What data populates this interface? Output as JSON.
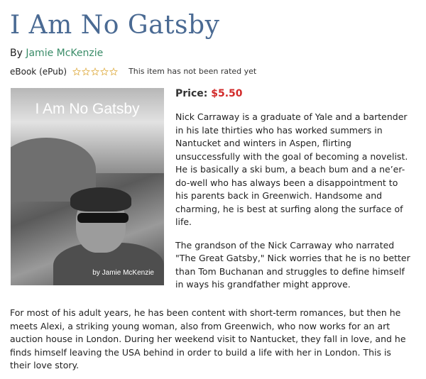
{
  "book": {
    "title": "I Am No Gatsby",
    "by_prefix": "By ",
    "author": "Jamie McKenzie",
    "format": "eBook (ePub)",
    "rating_note": "This item has not been rated yet",
    "rating_stars": 0,
    "rating_max": 5,
    "price_label": "Price:",
    "price_value": "$5.50",
    "cover": {
      "title": "I Am No Gatsby",
      "author": "by Jamie McKenzie",
      "image": "book-cover-photo"
    }
  },
  "description": {
    "p1": "Nick Carraway is a graduate of Yale and a bartender in his late thirties who has worked summers in Nantucket and winters in Aspen, flirting unsuccessfully with the goal of becoming a novelist. He is basically a ski bum, a beach bum and a ne’er-do-well who has always been a disappointment to his parents back in Greenwich. Handsome and charming, he is best at surfing along the surface of life.",
    "p2": "The grandson of the Nick Carraway who narrated \"The Great Gatsby,\" Nick worries that he is no better than Tom Buchanan and struggles to define himself in ways his grandfather might approve.",
    "p3": "For most of his adult years, he has been content with short-term romances, but then he meets Alexi, a striking young woman, also from Greenwich, who now works for an art auction house in London.  During her weekend visit to Nantucket, they fall in love, and he finds himself leaving the USA behind in order to build a life with her in London. This is their love story."
  },
  "colors": {
    "title": "#4a6a93",
    "author_link": "#3a8c68",
    "price": "#d22b2b",
    "star_outline": "#e0b04a"
  }
}
